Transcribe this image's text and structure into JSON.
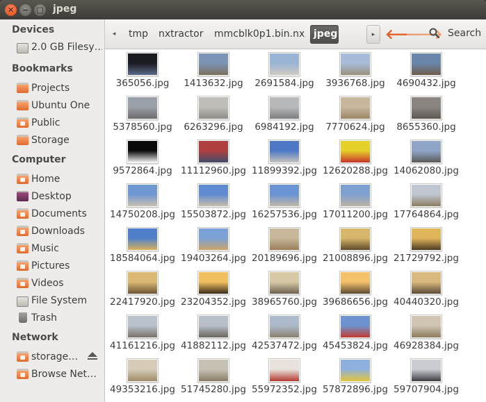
{
  "window": {
    "title": "jpeg"
  },
  "sidebar": {
    "sections": [
      {
        "label": "Devices",
        "items": [
          {
            "label": "2.0 GB Filesy…",
            "icon": "drive-icon"
          }
        ]
      },
      {
        "label": "Bookmarks",
        "items": [
          {
            "label": "Projects",
            "icon": "folder-icon"
          },
          {
            "label": "Ubuntu One",
            "icon": "folder-icon"
          },
          {
            "label": "Public",
            "icon": "folder-public-icon"
          },
          {
            "label": "Storage",
            "icon": "folder-icon"
          }
        ]
      },
      {
        "label": "Computer",
        "items": [
          {
            "label": "Home",
            "icon": "home-folder-icon"
          },
          {
            "label": "Desktop",
            "icon": "desktop-icon"
          },
          {
            "label": "Documents",
            "icon": "documents-folder-icon"
          },
          {
            "label": "Downloads",
            "icon": "downloads-folder-icon"
          },
          {
            "label": "Music",
            "icon": "music-folder-icon"
          },
          {
            "label": "Pictures",
            "icon": "pictures-folder-icon"
          },
          {
            "label": "Videos",
            "icon": "videos-folder-icon"
          },
          {
            "label": "File System",
            "icon": "drive-icon"
          },
          {
            "label": "Trash",
            "icon": "trash-icon"
          }
        ]
      },
      {
        "label": "Network",
        "items": [
          {
            "label": "storage…",
            "icon": "network-folder-icon",
            "eject": true
          },
          {
            "label": "Browse Net…",
            "icon": "network-folder-icon"
          }
        ]
      }
    ]
  },
  "toolbar": {
    "breadcrumbs": [
      "tmp",
      "nxtractor",
      "mmcblk0p1.bin.nx",
      "jpeg"
    ],
    "active_crumb": "jpeg",
    "search_label": "Search",
    "left_arrow": "◂",
    "right_arrow": "▸",
    "back_icon": "arrow-left-icon",
    "forward_icon": "arrow-right-icon",
    "accent_color": "#e05e22"
  },
  "files": [
    {
      "name": "365056.jpg",
      "c1": "#1b1b22",
      "c2": "#5a6a8a"
    },
    {
      "name": "1413632.jpg",
      "c1": "#7c95b7",
      "c2": "#7b6f5c"
    },
    {
      "name": "2691584.jpg",
      "c1": "#9ab4d6",
      "c2": "#cfcac0"
    },
    {
      "name": "3936768.jpg",
      "c1": "#a7bcd8",
      "c2": "#9a8f7e"
    },
    {
      "name": "4690432.jpg",
      "c1": "#6a86ad",
      "c2": "#6e5d48"
    },
    {
      "name": "5378560.jpg",
      "c1": "#9aa0a8",
      "c2": "#6c6c6e"
    },
    {
      "name": "6263296.jpg",
      "c1": "#bfbdb8",
      "c2": "#8e8c88"
    },
    {
      "name": "6984192.jpg",
      "c1": "#b7b9bb",
      "c2": "#7c7e80"
    },
    {
      "name": "7770624.jpg",
      "c1": "#c9b79d",
      "c2": "#9c8665"
    },
    {
      "name": "8655360.jpg",
      "c1": "#8a8581",
      "c2": "#5c5751"
    },
    {
      "name": "9572864.jpg",
      "c1": "#0a0a0a",
      "c2": "#f2f2f2"
    },
    {
      "name": "11112960.jpg",
      "c1": "#b04040",
      "c2": "#3e4d6b"
    },
    {
      "name": "11899392.jpg",
      "c1": "#4c78c6",
      "c2": "#c7c3bd"
    },
    {
      "name": "12620288.jpg",
      "c1": "#e6d02a",
      "c2": "#c6342a"
    },
    {
      "name": "14062080.jpg",
      "c1": "#8fa6c7",
      "c2": "#5a5a5a"
    },
    {
      "name": "14750208.jpg",
      "c1": "#6f97d2",
      "c2": "#c9bfb0"
    },
    {
      "name": "15503872.jpg",
      "c1": "#5f8bd0",
      "c2": "#c8bcaa"
    },
    {
      "name": "16257536.jpg",
      "c1": "#6a94d4",
      "c2": "#c3b7a6"
    },
    {
      "name": "17011200.jpg",
      "c1": "#7ea0d0",
      "c2": "#bcb2a3"
    },
    {
      "name": "17764864.jpg",
      "c1": "#c0c7d0",
      "c2": "#8c7c63"
    },
    {
      "name": "18584064.jpg",
      "c1": "#4f7fca",
      "c2": "#d9b25a"
    },
    {
      "name": "19403264.jpg",
      "c1": "#7aa0d5",
      "c2": "#c9a46a"
    },
    {
      "name": "20189696.jpg",
      "c1": "#c8b79a",
      "c2": "#9a7d58"
    },
    {
      "name": "21008896.jpg",
      "c1": "#d6b66a",
      "c2": "#5f4a2d"
    },
    {
      "name": "21729792.jpg",
      "c1": "#e0b55a",
      "c2": "#4b3a23"
    },
    {
      "name": "22417920.jpg",
      "c1": "#dcb874",
      "c2": "#6b5538"
    },
    {
      "name": "23204352.jpg",
      "c1": "#f0c060",
      "c2": "#3b2c1c"
    },
    {
      "name": "38965760.jpg",
      "c1": "#d7c9a6",
      "c2": "#6d6250"
    },
    {
      "name": "39686656.jpg",
      "c1": "#f2c16a",
      "c2": "#5e4b33"
    },
    {
      "name": "40440320.jpg",
      "c1": "#d9b97e",
      "c2": "#5b4a36"
    },
    {
      "name": "41161216.jpg",
      "c1": "#b8c1cc",
      "c2": "#7a7167"
    },
    {
      "name": "41882112.jpg",
      "c1": "#b7bfc9",
      "c2": "#6c655d"
    },
    {
      "name": "42537472.jpg",
      "c1": "#adbacb",
      "c2": "#8a7f70"
    },
    {
      "name": "45453824.jpg",
      "c1": "#6c93d0",
      "c2": "#c43a30"
    },
    {
      "name": "46928384.jpg",
      "c1": "#d0c5b2",
      "c2": "#8d7b5c"
    },
    {
      "name": "49353216.jpg",
      "c1": "#d6cbb7",
      "c2": "#a08b67"
    },
    {
      "name": "51745280.jpg",
      "c1": "#c6c0b2",
      "c2": "#8a7d67"
    },
    {
      "name": "55972352.jpg",
      "c1": "#e7e2dc",
      "c2": "#b53b32"
    },
    {
      "name": "57872896.jpg",
      "c1": "#8fb0de",
      "c2": "#e2c53a"
    },
    {
      "name": "59707904.jpg",
      "c1": "#c9ccd1",
      "c2": "#3d3d40"
    }
  ]
}
